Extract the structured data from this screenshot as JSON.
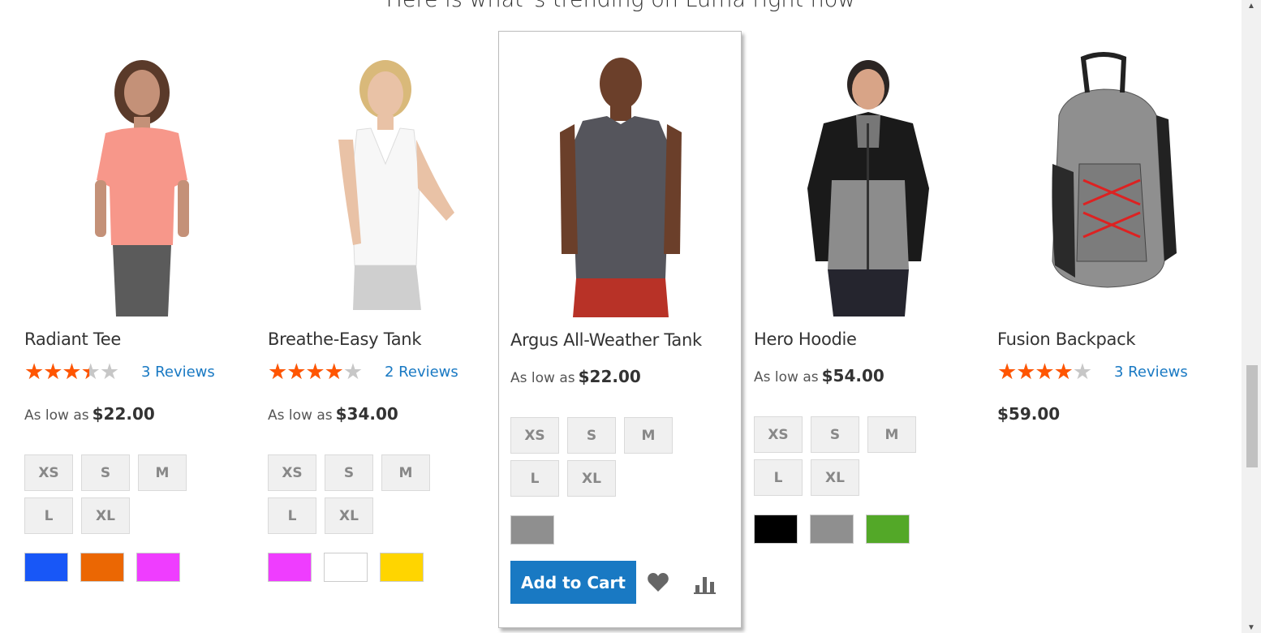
{
  "heading": "Here is what`s trending on Luma right now",
  "products": [
    {
      "name": "Radiant Tee",
      "rating_pct": 60,
      "reviews": "3 Reviews",
      "price_prefix": "As low as",
      "price": "$22.00",
      "sizes": [
        "XS",
        "S",
        "M",
        "L",
        "XL"
      ],
      "colors": [
        "#1857f7",
        "#eb6703",
        "#ef3dff"
      ]
    },
    {
      "name": "Breathe-Easy Tank",
      "rating_pct": 70,
      "reviews": "2 Reviews",
      "price_prefix": "As low as",
      "price": "$34.00",
      "sizes": [
        "XS",
        "S",
        "M",
        "L",
        "XL"
      ],
      "colors": [
        "#ef3dff",
        "#ffffff",
        "#ffd500"
      ]
    },
    {
      "name": "Argus All-Weather Tank",
      "price_prefix": "As low as",
      "price": "$22.00",
      "sizes": [
        "XS",
        "S",
        "M",
        "L",
        "XL"
      ],
      "colors": [
        "#8f8f8f"
      ],
      "add_to_cart": "Add to Cart"
    },
    {
      "name": "Hero Hoodie",
      "price_prefix": "As low as",
      "price": "$54.00",
      "sizes": [
        "XS",
        "S",
        "M",
        "L",
        "XL"
      ],
      "colors": [
        "#000000",
        "#8f8f8f",
        "#53a828"
      ]
    },
    {
      "name": "Fusion Backpack",
      "rating_pct": 70,
      "reviews": "3 Reviews",
      "price": "$59.00"
    }
  ],
  "icons": {
    "wishlist": "heart-icon",
    "compare": "bar-chart-icon",
    "star": "star-icon"
  },
  "colors": {
    "accent": "#1979c3",
    "star_active": "#ff5501",
    "star_inactive": "#c7c7c7"
  }
}
